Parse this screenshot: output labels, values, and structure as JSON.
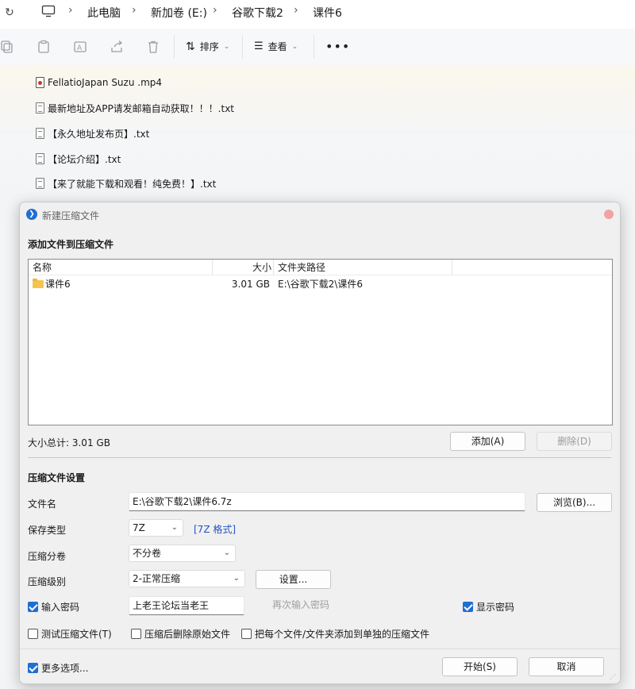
{
  "explorer": {
    "breadcrumb": [
      "此电脑",
      "新加卷 (E:)",
      "谷歌下载2",
      "课件6"
    ],
    "toolbar": {
      "sort_label": "排序",
      "view_label": "查看",
      "more_label": "•••"
    },
    "files": [
      {
        "name": "FellatioJapan Suzu .mp4",
        "type": "mp4"
      },
      {
        "name": "最新地址及APP请发邮箱自动获取！！！.txt",
        "type": "txt"
      },
      {
        "name": "【永久地址发布页】.txt",
        "type": "txt"
      },
      {
        "name": "【论坛介绍】.txt",
        "type": "txt"
      },
      {
        "name": "【来了就能下载和观看！纯免费！】.txt",
        "type": "txt"
      }
    ]
  },
  "dialog": {
    "title": "新建压缩文件",
    "add_section_title": "添加文件到压缩文件",
    "columns": {
      "name": "名称",
      "size": "大小",
      "path": "文件夹路径"
    },
    "items": [
      {
        "name": "课件6",
        "size": "3.01 GB",
        "path": "E:\\谷歌下载2\\课件6"
      }
    ],
    "total_size": "大小总计: 3.01 GB",
    "add_button": "添加(A)",
    "delete_button": "删除(D)",
    "settings_section_title": "压缩文件设置",
    "filename_label": "文件名",
    "filename_value": "E:\\谷歌下载2\\课件6.7z",
    "browse_button": "浏览(B)...",
    "save_type_label": "保存类型",
    "save_type_value": "7Z",
    "format_link": "[7Z 格式]",
    "split_label": "压缩分卷",
    "split_value": "不分卷",
    "level_label": "压缩级别",
    "level_value": "2-正常压缩",
    "settings_button": "设置...",
    "password_label": "输入密码",
    "password_value": "上老王论坛当老王",
    "reenter_placeholder": "再次输入密码",
    "show_password_label": "显示密码",
    "test_archive_label": "测试压缩文件(T)",
    "delete_after_label": "压缩后删除原始文件",
    "separate_archive_label": "把每个文件/文件夹添加到单独的压缩文件",
    "more_options_label": "更多选项...",
    "start_button": "开始(S)",
    "cancel_button": "取消",
    "checks": {
      "password": true,
      "show_password": true,
      "test_archive": false,
      "delete_after": false,
      "separate_archive": false,
      "more_options": true
    }
  }
}
